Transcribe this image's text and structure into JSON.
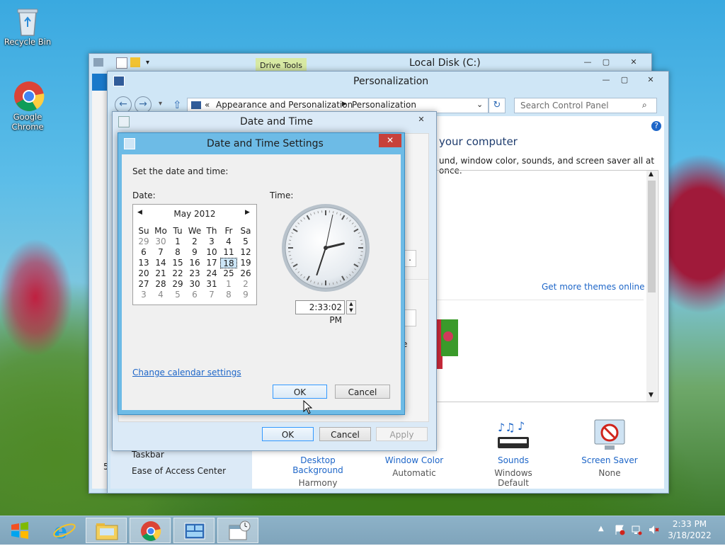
{
  "desktop": {
    "icons": [
      {
        "label": "Recycle Bin",
        "icon": "recycle-bin-icon"
      },
      {
        "label": "Google Chrome",
        "icon": "chrome-icon"
      }
    ]
  },
  "explorer": {
    "title": "Local Disk (C:)",
    "ribbon_tab": "Drive Tools"
  },
  "personalization": {
    "title": "Personalization",
    "breadcrumb": [
      "«",
      "Appearance and Personalization",
      "Personalization"
    ],
    "search_placeholder": "Search Control Panel",
    "heading": "your computer",
    "subheading": "und, window color, sounds, and screen saver all at once.",
    "get_more_themes": "Get more themes online",
    "partial_e": "e",
    "see_also": [
      "Taskbar",
      "Ease of Access Center"
    ],
    "partial_5": "5",
    "bottom_items": [
      {
        "label": "Desktop Background",
        "value": "Harmony"
      },
      {
        "label": "Window Color",
        "value": "Automatic"
      },
      {
        "label": "Sounds",
        "value": "Windows Default"
      },
      {
        "label": "Screen Saver",
        "value": "None"
      }
    ]
  },
  "date_time": {
    "title": "Date and Time",
    "ok": "OK",
    "cancel": "Cancel",
    "apply": "Apply"
  },
  "settings": {
    "title": "Date and Time Settings",
    "instruction": "Set the date and time:",
    "date_label": "Date:",
    "time_label": "Time:",
    "month": "May 2012",
    "weekdays": [
      "Su",
      "Mo",
      "Tu",
      "We",
      "Th",
      "Fr",
      "Sa"
    ],
    "weeks": [
      [
        "29",
        "30",
        "1",
        "2",
        "3",
        "4",
        "5"
      ],
      [
        "6",
        "7",
        "8",
        "9",
        "10",
        "11",
        "12"
      ],
      [
        "13",
        "14",
        "15",
        "16",
        "17",
        "18",
        "19"
      ],
      [
        "20",
        "21",
        "22",
        "23",
        "24",
        "25",
        "26"
      ],
      [
        "27",
        "28",
        "29",
        "30",
        "31",
        "1",
        "2"
      ],
      [
        "3",
        "4",
        "5",
        "6",
        "7",
        "8",
        "9"
      ]
    ],
    "selected_day": "18",
    "time_value": "2:33:02 PM",
    "clock": {
      "hour": 2,
      "minute": 33,
      "second": 2
    },
    "change_calendar": "Change calendar settings",
    "ok": "OK",
    "cancel": "Cancel"
  },
  "taskbar": {
    "clock_time": "2:33 PM",
    "clock_date": "3/18/2022",
    "items": [
      "start-button",
      "internet-explorer",
      "file-explorer",
      "chrome",
      "control-panel",
      "date-time"
    ]
  }
}
